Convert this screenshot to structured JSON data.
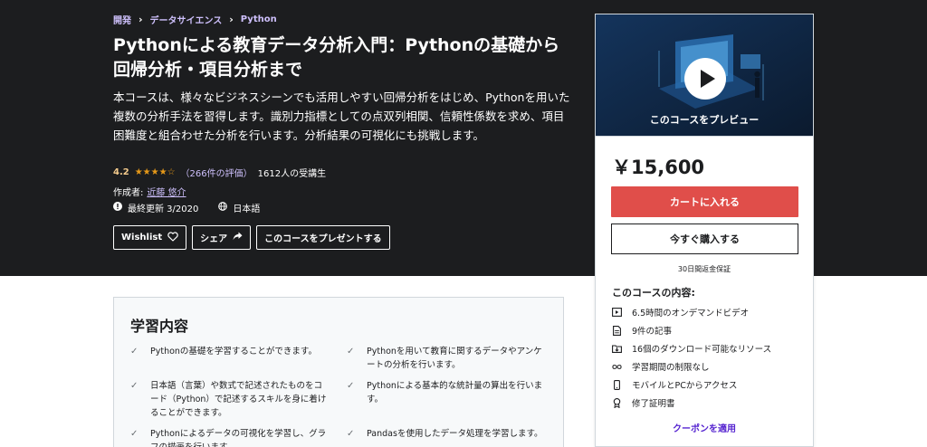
{
  "breadcrumb": [
    "開発",
    "データサイエンス",
    "Python"
  ],
  "breadcrumb_sep": "›",
  "course": {
    "title": "Pythonによる教育データ分析入門：Pythonの基礎から回帰分析・項目分析まで",
    "subtitle": "本コースは、様々なビジネスシーンでも活用しやすい回帰分析をはじめ、Pythonを用いた複数の分析手法を習得します。識別力指標としての点双列相関、信頼性係数を求め、項目困難度と組合わせた分析を行います。分析結果の可視化にも挑戦します。",
    "rating": "4.2",
    "stars": "★★★★☆",
    "rating_count": "（266件の評価）",
    "students": "1612人の受講生",
    "author_label": "作成者:",
    "author_name": "近藤 悠介",
    "last_updated": "最終更新 3/2020",
    "language": "日本語"
  },
  "buttons": {
    "wishlist": "Wishlist",
    "share": "シェア",
    "gift": "このコースをプレゼントする"
  },
  "sidebar": {
    "preview_label": "このコースをプレビュー",
    "price": "￥15,600",
    "cart": "カートに入れる",
    "buy_now": "今すぐ購入する",
    "guarantee": "30日間返金保証",
    "includes_title": "このコースの内容:",
    "includes": [
      {
        "icon": "video-icon",
        "text": "6.5時間のオンデマンドビデオ"
      },
      {
        "icon": "article-icon",
        "text": "9件の記事"
      },
      {
        "icon": "download-icon",
        "text": "16個のダウンロード可能なリソース"
      },
      {
        "icon": "infinity-icon",
        "text": "学習期間の制限なし"
      },
      {
        "icon": "mobile-icon",
        "text": "モバイルとPCからアクセス"
      },
      {
        "icon": "certificate-icon",
        "text": "修了証明書"
      }
    ],
    "coupon": "クーポンを適用"
  },
  "learn": {
    "title": "学習内容",
    "items": [
      "Pythonの基礎を学習することができます。",
      "Pythonを用いて教育に関するデータやアンケートの分析を行います。",
      "日本語（言葉）や数式で記述されたものをコード（Python）で記述するスキルを身に着けることができます。",
      "Pythonによる基本的な統計量の算出を行います。",
      "Pythonによるデータの可視化を学習し、グラフの描画を行います。",
      "Pandasを使用したデータ処理を学習します。"
    ]
  },
  "colors": {
    "hero_bg": "#1c1d1f",
    "accent_purple": "#cec0fc",
    "star": "#e59819",
    "cart_red": "#e04e4a",
    "coupon": "#5624d0"
  }
}
